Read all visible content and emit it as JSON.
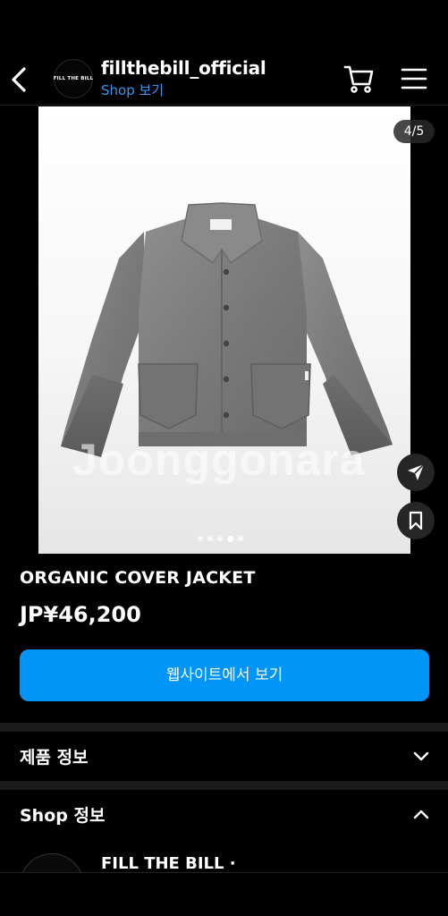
{
  "header": {
    "account_name": "fillthebill_official",
    "shop_link": "Shop 보기",
    "avatar_text": "FILL THE BILL",
    "back_icon": "chevron-left-icon",
    "cart_icon": "cart-icon",
    "menu_icon": "hamburger-menu-icon"
  },
  "gallery": {
    "counter": "4/5",
    "watermark": "Joonggonara",
    "total_images": 5,
    "current_index": 4
  },
  "product": {
    "title": "ORGANIC COVER JACKET",
    "price": "JP¥46,200",
    "website_button": "웹사이트에서 보기"
  },
  "sections": {
    "product_info": "제품 정보",
    "shop_info": "Shop 정보"
  },
  "shop": {
    "name": "FILL THE BILL ·"
  },
  "colors": {
    "background": "#000000",
    "accent": "#0095f6",
    "link": "#3897f0"
  }
}
